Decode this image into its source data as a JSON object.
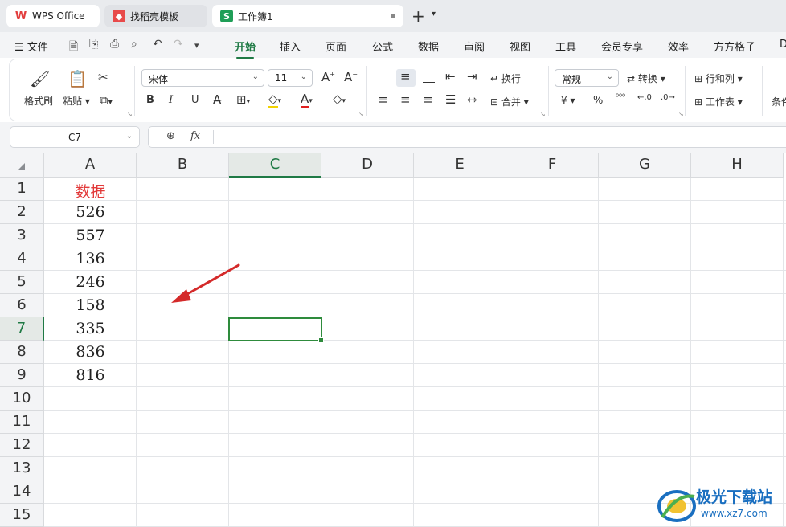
{
  "tabs": [
    {
      "label": "WPS Office",
      "icon": "wps-logo-icon"
    },
    {
      "label": "找稻壳模板",
      "icon": "docer-icon"
    },
    {
      "label": "工作簿1",
      "icon": "spreadsheet-icon",
      "active": true
    }
  ],
  "menu": {
    "file_label": "文件",
    "items": [
      "开始",
      "插入",
      "页面",
      "公式",
      "数据",
      "审阅",
      "视图",
      "工具",
      "会员专享",
      "效率",
      "方方格子",
      "D"
    ],
    "active": "开始"
  },
  "ribbon": {
    "format_painter": "格式刷",
    "paste": "粘贴",
    "font_name": "宋体",
    "font_size": "11",
    "bold": "B",
    "italic": "I",
    "underline": "U",
    "wrap_text": "换行",
    "merge": "合并",
    "number_format": "常规",
    "convert": "转换",
    "rows_cols": "行和列",
    "worksheet": "工作表",
    "cond_partial": "条件",
    "currency": "¥",
    "percent": "%"
  },
  "formula_bar": {
    "cell_ref": "C7",
    "fx_label": "fx",
    "value": ""
  },
  "columns": [
    "A",
    "B",
    "C",
    "D",
    "E",
    "F",
    "G",
    "H"
  ],
  "rows": [
    "1",
    "2",
    "3",
    "4",
    "5",
    "6",
    "7",
    "8",
    "9",
    "10",
    "11",
    "12",
    "13",
    "14",
    "15"
  ],
  "selected": {
    "column": "C",
    "row": "7"
  },
  "cells_A": [
    "数据",
    "526",
    "557",
    "136",
    "246",
    "158",
    "335",
    "836",
    "816"
  ],
  "watermark": {
    "name": "极光下载站",
    "url": "www.xz7.com"
  },
  "colors": {
    "accent": "#1f7a45",
    "header_text": "#e23a3a",
    "arrow": "#d42a2a"
  }
}
